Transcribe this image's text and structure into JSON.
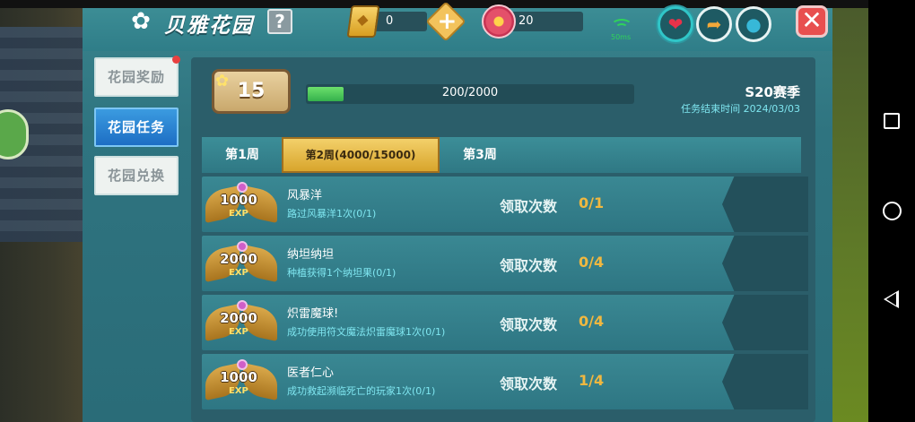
{
  "header": {
    "title": "贝雅花园",
    "help": "?",
    "gold_count": "0",
    "gem_count": "20",
    "ping": "50ms"
  },
  "side_nav": [
    {
      "label": "花园奖励",
      "active": false,
      "has_dot": true
    },
    {
      "label": "花园任务",
      "active": true,
      "has_dot": false
    },
    {
      "label": "花园兑换",
      "active": false,
      "has_dot": false
    }
  ],
  "level": "15",
  "progress": {
    "text": "200/2000",
    "value": 200,
    "max": 2000
  },
  "season": {
    "name": "S20赛季",
    "end": "任务结束时间  2024/03/03"
  },
  "tabs": [
    {
      "label": "第1周",
      "active": false
    },
    {
      "label": "第2周(4000/15000)",
      "active": true
    },
    {
      "label": "第3周",
      "active": false
    }
  ],
  "tasks": [
    {
      "exp": "1000",
      "name": "风暴洋",
      "desc": "路过风暴洋1次(0/1)",
      "claim_label": "领取次数",
      "claim": "0/1"
    },
    {
      "exp": "2000",
      "name": "纳坦纳坦",
      "desc": "种植获得1个纳坦果(0/1)",
      "claim_label": "领取次数",
      "claim": "0/4"
    },
    {
      "exp": "2000",
      "name": "炽雷魔球!",
      "desc": "成功使用符文魔法炽雷魔球1次(0/1)",
      "claim_label": "领取次数",
      "claim": "0/4"
    },
    {
      "exp": "1000",
      "name": "医者仁心",
      "desc": "成功救起濒临死亡的玩家1次(0/1)",
      "claim_label": "领取次数",
      "claim": "1/4"
    }
  ],
  "exp_tag": "EXP",
  "colors": {
    "accent": "#2f7884",
    "gold": "#f0b840",
    "active_nav": "#1d6ec4"
  }
}
